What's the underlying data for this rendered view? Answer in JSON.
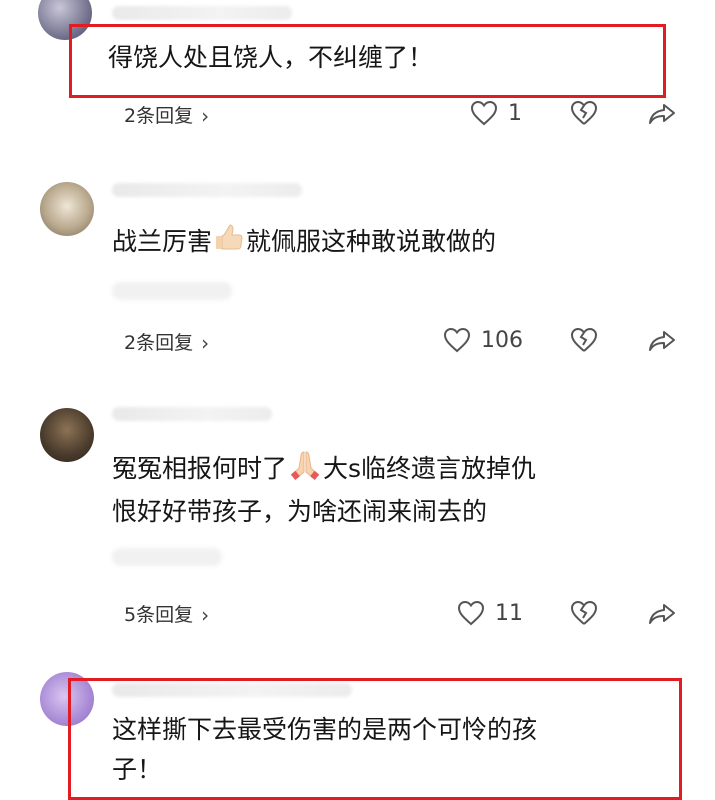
{
  "comments": [
    {
      "text": "得饶人处且饶人，不纠缠了！",
      "replies_label": "2条回复",
      "likes": "1",
      "highlighted": true
    },
    {
      "text_parts": [
        "战兰厉害",
        "就佩服这种敢说敢做的"
      ],
      "emoji": "thumbs-up-emoji",
      "replies_label": "2条回复",
      "likes": "106"
    },
    {
      "text_parts": [
        "冤冤相报何时了",
        "大s临终遗言放掉仇",
        "恨好好带孩子，为啥还闹来闹去的"
      ],
      "emoji": "praying-hands-emoji",
      "replies_label": "5条回复",
      "likes": "11"
    },
    {
      "text_line1": "这样撕下去最受伤害的是两个可怜的孩",
      "text_line2": "子！",
      "highlighted": true
    }
  ],
  "colors": {
    "highlight_border": "#e21c23",
    "reply_pill_bg": "#f3f3f3"
  }
}
